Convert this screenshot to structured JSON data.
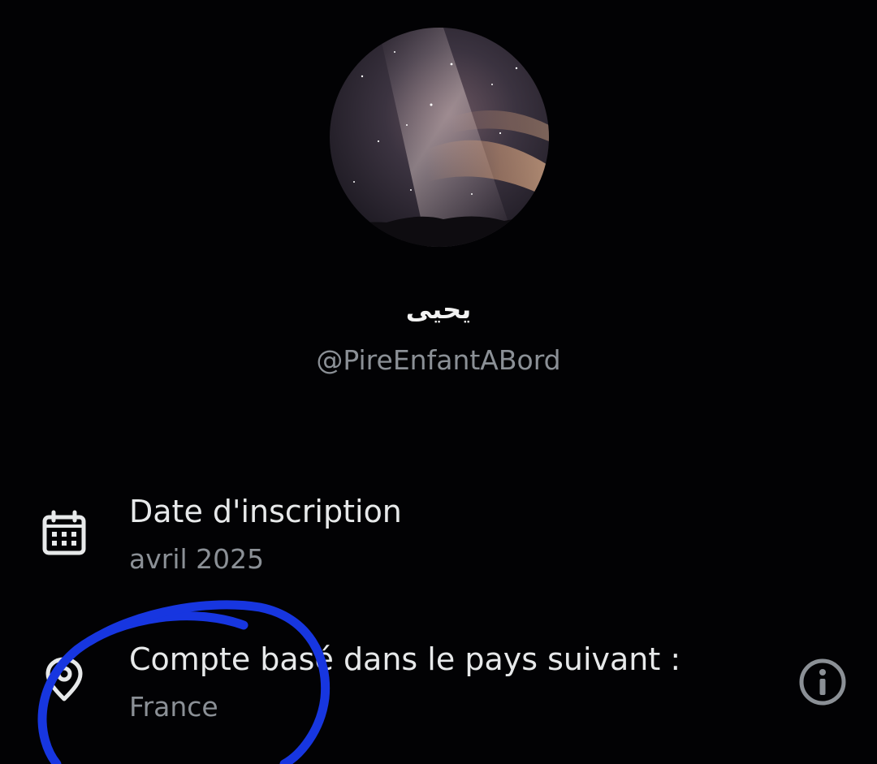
{
  "profile": {
    "display_name": "يحيى",
    "handle": "@PireEnfantABord"
  },
  "details": [
    {
      "icon": "calendar-icon",
      "title": "Date d'inscription",
      "value": "avril 2025"
    },
    {
      "icon": "location-pin-icon",
      "title": "Compte basé dans le pays suivant :",
      "value": "France"
    }
  ],
  "info_icon": "info-icon",
  "colors": {
    "background": "#020204",
    "primary_text": "#e7e9ea",
    "secondary_text": "#8b9096",
    "annotation": "#1736e0"
  }
}
